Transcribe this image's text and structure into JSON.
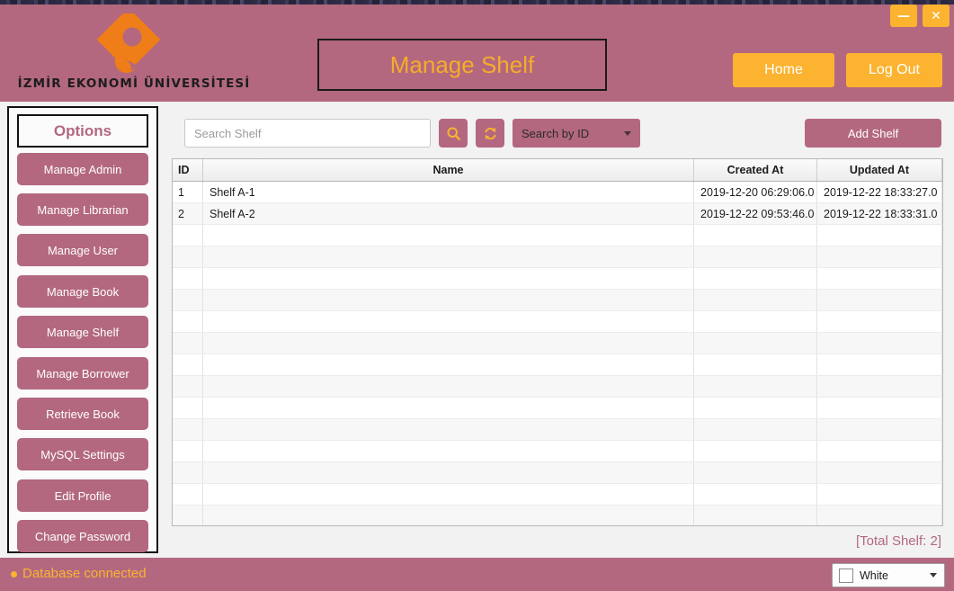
{
  "window": {
    "minimize_label": "—",
    "close_label": "✕"
  },
  "header": {
    "university_name": "İZMİR EKONOMİ ÜNİVERSİTESİ",
    "title": "Manage Shelf",
    "home_label": "Home",
    "logout_label": "Log Out"
  },
  "sidebar": {
    "heading": "Options",
    "items": [
      {
        "label": "Manage Admin"
      },
      {
        "label": "Manage Librarian"
      },
      {
        "label": "Manage User"
      },
      {
        "label": "Manage Book"
      },
      {
        "label": "Manage Shelf"
      },
      {
        "label": "Manage Borrower"
      },
      {
        "label": "Retrieve Book"
      },
      {
        "label": "MySQL Settings"
      },
      {
        "label": "Edit Profile"
      },
      {
        "label": "Change Password"
      }
    ]
  },
  "toolbar": {
    "search_placeholder": "Search Shelf",
    "search_value": "",
    "search_icon": "search-icon",
    "refresh_icon": "refresh-icon",
    "search_by_value": "Search by ID",
    "add_label": "Add Shelf"
  },
  "table": {
    "columns": [
      "ID",
      "Name",
      "Created At",
      "Updated At"
    ],
    "rows": [
      {
        "id": "1",
        "name": "Shelf A-1",
        "created_at": "2019-12-20 06:29:06.0",
        "updated_at": "2019-12-22 18:33:27.0"
      },
      {
        "id": "2",
        "name": "Shelf A-2",
        "created_at": "2019-12-22 09:53:46.0",
        "updated_at": "2019-12-22 18:33:31.0"
      }
    ],
    "empty_row_count": 15
  },
  "footer": {
    "total_label": "[Total Shelf: 2]",
    "db_status": "Database connected",
    "theme_value": "White"
  },
  "colors": {
    "brand_pink": "#b3687f",
    "accent_orange": "#fbb330",
    "title_orange": "#f5ac2a"
  }
}
